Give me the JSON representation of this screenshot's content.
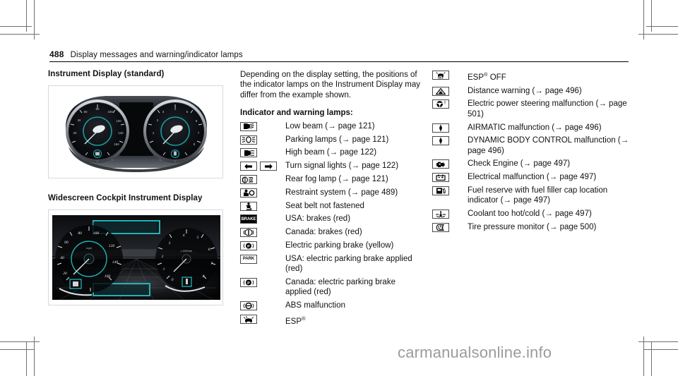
{
  "header": {
    "page_number": "488",
    "title": "Display messages and warning/indicator lamps"
  },
  "left_column": {
    "heading_1": "Instrument Display (standard)",
    "heading_2": "Widescreen Cockpit Instrument Display",
    "figure_1_name": "instrument-display-standard-illustration",
    "figure_2_name": "widescreen-cockpit-display-illustration",
    "gauge_labels_standard": {
      "speed_ticks": [
        "20",
        "40",
        "60",
        "80",
        "100",
        "120",
        "140",
        "160"
      ],
      "rpm_ticks": [
        "0",
        "1",
        "2",
        "3",
        "4",
        "5",
        "6",
        "7",
        "8"
      ]
    },
    "gauge_labels_wide": {
      "speed_ticks": [
        "0",
        "20",
        "40",
        "60",
        "80",
        "100",
        "120",
        "140",
        "160"
      ],
      "speed_unit": "mph",
      "rpm_ticks": [
        "0",
        "1",
        "2",
        "3",
        "4",
        "5",
        "6",
        "7",
        "8"
      ],
      "rpm_unit": "x 1000/min"
    }
  },
  "middle_column": {
    "intro": "Depending on the display setting, the positions of the indicator lamps on the Instrument Display may differ from the example shown.",
    "lamps_heading": "Indicator and warning lamps:",
    "lamps": [
      {
        "icons": [
          "low-beam"
        ],
        "text": "Low beam (→ page 121)"
      },
      {
        "icons": [
          "parking-lamps"
        ],
        "text": "Parking lamps (→ page 121)"
      },
      {
        "icons": [
          "high-beam"
        ],
        "text": "High beam (→ page 122)"
      },
      {
        "icons": [
          "turn-left",
          "turn-right"
        ],
        "text": "Turn signal lights (→ page 122)"
      },
      {
        "icons": [
          "rear-fog-lamp"
        ],
        "text": "Rear fog lamp (→ page 121)"
      },
      {
        "icons": [
          "restraint-system"
        ],
        "text": "Restraint system (→ page 489)"
      },
      {
        "icons": [
          "seat-belt"
        ],
        "text": "Seat belt not fastened"
      },
      {
        "icons": [
          "brake-usa"
        ],
        "text": "USA: brakes (red)"
      },
      {
        "icons": [
          "brake-canada"
        ],
        "text": "Canada: brakes (red)"
      },
      {
        "icons": [
          "electric-parking-brake"
        ],
        "text": "Electric parking brake (yellow)"
      },
      {
        "icons": [
          "park-usa"
        ],
        "text": "USA: electric parking brake applied (red)"
      },
      {
        "icons": [
          "park-canada"
        ],
        "text": "Canada: electric parking brake applied (red)"
      },
      {
        "icons": [
          "abs"
        ],
        "text": "ABS malfunction"
      },
      {
        "icons": [
          "esp"
        ],
        "text": "ESP®",
        "has_reg": true,
        "base": "ESP"
      }
    ]
  },
  "right_column": {
    "lamps": [
      {
        "icons": [
          "esp-off"
        ],
        "base": "ESP",
        "suffix": " OFF",
        "has_reg": true,
        "text": "ESP® OFF"
      },
      {
        "icons": [
          "distance-warning"
        ],
        "text": "Distance warning (→ page 496)"
      },
      {
        "icons": [
          "power-steering"
        ],
        "text": "Electric power steering malfunction (→ page 501)"
      },
      {
        "icons": [
          "airmatic"
        ],
        "text": "AIRMATIC malfunction (→ page 496)"
      },
      {
        "icons": [
          "dynamic-body-control"
        ],
        "text": "DYNAMIC BODY CONTROL malfunction (→ page 496)"
      },
      {
        "icons": [
          "check-engine"
        ],
        "text": "Check Engine (→ page 497)"
      },
      {
        "icons": [
          "electrical-malfunction"
        ],
        "text": "Electrical malfunction (→ page 497)"
      },
      {
        "icons": [
          "fuel-reserve"
        ],
        "text": "Fuel reserve with fuel filler cap location indicator (→ page 497)"
      },
      {
        "icons": [
          "coolant-temp"
        ],
        "text": "Coolant too hot/cold (→ page 497)"
      },
      {
        "icons": [
          "tire-pressure"
        ],
        "text": "Tire pressure monitor (→ page 500)"
      }
    ]
  },
  "watermark": {
    "text": "carmanualsonline.info"
  },
  "colors": {
    "accent_teal": "#199aa0",
    "text": "#111111",
    "rule": "#000000",
    "figure_border": "#d9d9d9",
    "crop_mark": "#6f6f6f",
    "watermark": "#9b9b9b"
  }
}
